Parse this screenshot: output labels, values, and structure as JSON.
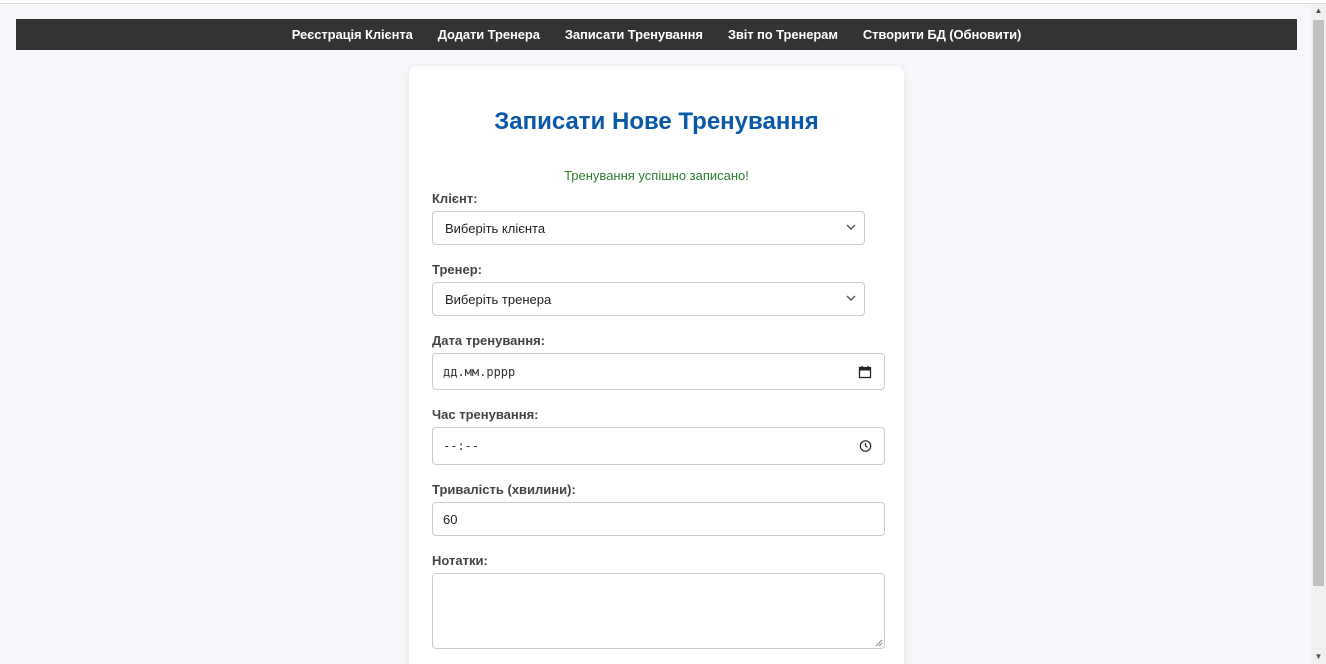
{
  "nav": {
    "items": [
      "Реєстрація Клієнта",
      "Додати Тренера",
      "Записати Тренування",
      "Звіт по Тренерам",
      "Створити БД (Обновити)"
    ]
  },
  "form": {
    "title": "Записати Нове Тренування",
    "success_message": "Тренування успішно записано!",
    "client": {
      "label": "Клієнт:",
      "selected": "Виберіть клієнта"
    },
    "trainer": {
      "label": "Тренер:",
      "selected": "Виберіть тренера"
    },
    "date": {
      "label": "Дата тренування:",
      "placeholder": "дд.мм.рррр"
    },
    "time": {
      "label": "Час тренування:",
      "placeholder": "--:--"
    },
    "duration": {
      "label": "Тривалість (хвилини):",
      "value": "60"
    },
    "notes": {
      "label": "Нотатки:",
      "value": ""
    }
  },
  "colors": {
    "navbar_bg": "#333333",
    "title": "#0a58a8",
    "success": "#2e7d32",
    "page_bg": "#f5f7fa"
  }
}
